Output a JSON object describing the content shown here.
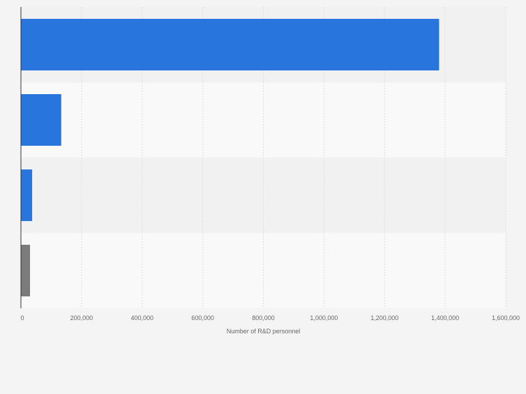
{
  "chart_data": {
    "type": "bar",
    "orientation": "horizontal",
    "categories": [
      "",
      "",
      "",
      ""
    ],
    "values": [
      1380000,
      133000,
      37000,
      30000
    ],
    "bar_colors": [
      "#2876dd",
      "#2876dd",
      "#2876dd",
      "#7b7b7b"
    ],
    "xlabel": "Number of R&D personnel",
    "ylabel": "",
    "xlim": [
      0,
      1600000
    ],
    "x_ticks": [
      0,
      200000,
      400000,
      600000,
      800000,
      1000000,
      1200000,
      1400000,
      1600000
    ],
    "x_tick_labels": [
      "0",
      "200,000",
      "400,000",
      "600,000",
      "800,000",
      "1,000,000",
      "1,200,000",
      "1,400,000",
      "1,600,000"
    ],
    "grid": true,
    "legend": "none"
  },
  "colors": {
    "background": "#f4f4f4",
    "band_dark": "#f1f1f1",
    "band_light": "#f9f9f9",
    "gridline": "#dcdcdc",
    "axis": "#333333",
    "tick_text": "#666666"
  }
}
